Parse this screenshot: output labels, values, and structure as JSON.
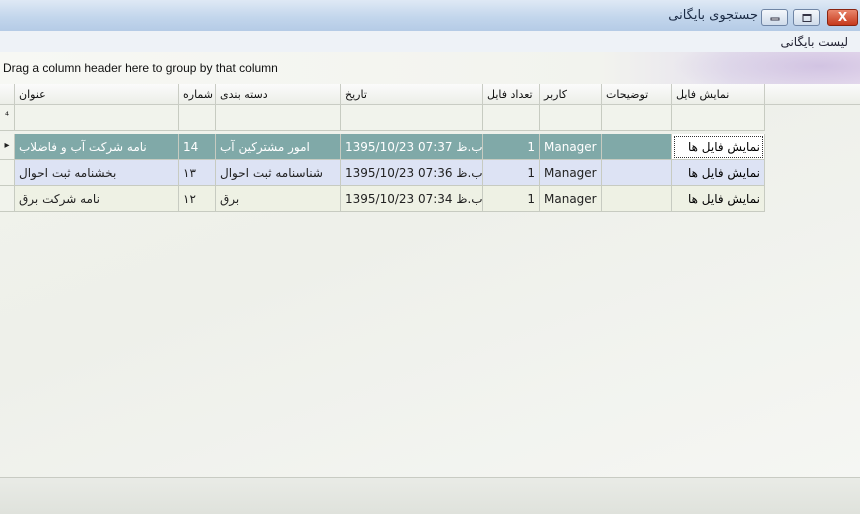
{
  "window": {
    "title": "جستجوی بایگانی",
    "close_glyph": "X"
  },
  "menu": {
    "label": "لیست بایگانی"
  },
  "group_panel": {
    "hint": "Drag a column header here to group by that column"
  },
  "grid": {
    "columns": [
      "عنوان",
      "شماره",
      "دسته بندی",
      "تاریخ",
      "تعداد فایل",
      "کاربر",
      "توضیحات",
      "نمایش فایل"
    ],
    "filter_row_glyph": "⁴",
    "current_row_glyph": "▸",
    "rows": [
      {
        "title": "نامه شرکت آب و فاضلاب",
        "number": "14",
        "category": "امور مشترکین آب",
        "date": "1395/10/23 07:37 ب.ظ",
        "files": "1",
        "user": "Manager",
        "notes": "",
        "view": "نمایش فایل ها"
      },
      {
        "title": "بخشنامه ثبت احوال",
        "number": "۱۳",
        "category": "شناسنامه ثبت احوال",
        "date": "1395/10/23 07:36 ب.ظ",
        "files": "1",
        "user": "Manager",
        "notes": "",
        "view": "نمایش فایل ها"
      },
      {
        "title": "نامه شرکت برق",
        "number": "۱۲",
        "category": "برق",
        "date": "1395/10/23 07:34 ب.ظ",
        "files": "1",
        "user": "Manager",
        "notes": "",
        "view": "نمایش فایل ها"
      }
    ]
  }
}
